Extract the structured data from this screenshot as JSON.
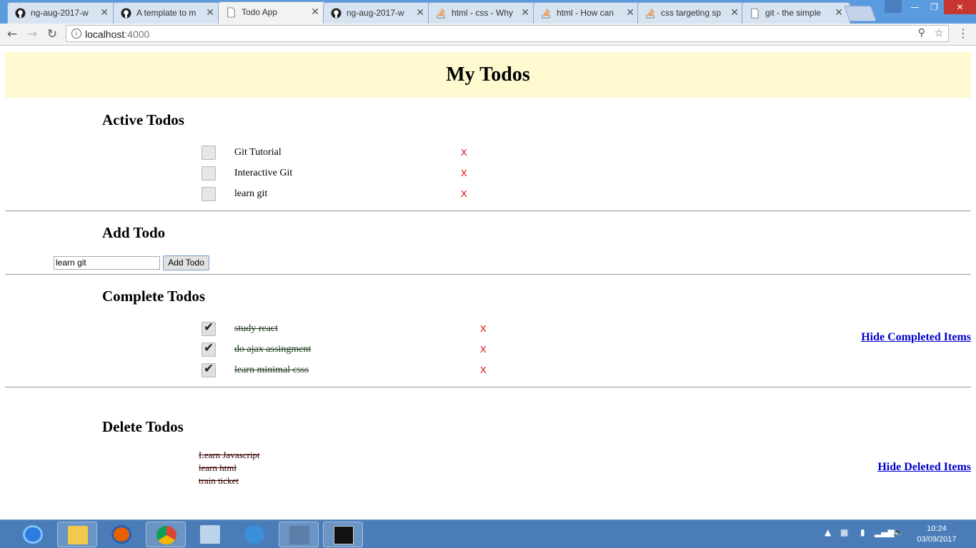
{
  "browser": {
    "tabs": [
      {
        "title": "ng-aug-2017-w",
        "icon": "github-icon",
        "active": false
      },
      {
        "title": "A template to m",
        "icon": "github-icon",
        "active": false
      },
      {
        "title": "Todo App",
        "icon": "page-icon",
        "active": true
      },
      {
        "title": "ng-aug-2017-w",
        "icon": "github-icon",
        "active": false
      },
      {
        "title": "html - css - Why",
        "icon": "stackoverflow-icon",
        "active": false
      },
      {
        "title": "html - How can",
        "icon": "stackoverflow-icon",
        "active": false
      },
      {
        "title": "css targeting sp",
        "icon": "stackoverflow-icon",
        "active": false
      },
      {
        "title": "git - the simple",
        "icon": "page-icon",
        "active": false
      }
    ],
    "url_host": "localhost",
    "url_port": ":4000"
  },
  "page": {
    "title": "My Todos",
    "active_section_title": "Active Todos",
    "active_todos": [
      {
        "text": "Git Tutorial",
        "delete": "X"
      },
      {
        "text": "Interactive Git",
        "delete": "X"
      },
      {
        "text": "learn git",
        "delete": "X"
      }
    ],
    "add_section_title": "Add Todo",
    "add_input_value": "learn git",
    "add_button_label": "Add Todo",
    "complete_section_title": "Complete Todos",
    "complete_todos": [
      {
        "text": "study react",
        "delete": "X"
      },
      {
        "text": "do ajax assingment",
        "delete": "X"
      },
      {
        "text": "learn minimal csss",
        "delete": "X"
      }
    ],
    "hide_completed_label": "Hide Completed Items",
    "delete_section_title": "Delete Todos",
    "deleted_todos": [
      "Learn Javascript",
      "learn html",
      "train ticket"
    ],
    "hide_deleted_label": "Hide Deleted Items"
  },
  "taskbar": {
    "time": "10:24",
    "date": "03/09/2017"
  },
  "colors": {
    "header_bg": "#fff9d0",
    "delete_x": "#e00000",
    "link": "#0000cc",
    "taskbar": "#4a7db8"
  }
}
